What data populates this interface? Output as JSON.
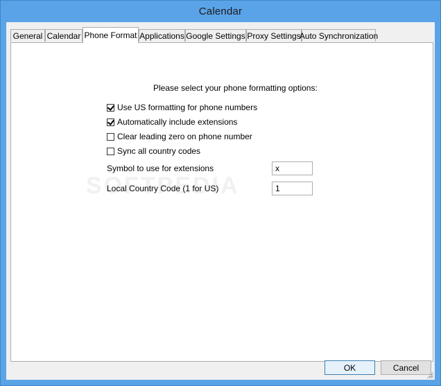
{
  "window": {
    "title": "Calendar"
  },
  "tabs": [
    {
      "label": "General"
    },
    {
      "label": "Calendar"
    },
    {
      "label": "Phone Format"
    },
    {
      "label": "Applications"
    },
    {
      "label": "Google Settings"
    },
    {
      "label": "Proxy Settings"
    },
    {
      "label": "Auto Synchronization"
    }
  ],
  "phone_format": {
    "prompt": "Please select your phone formatting options:",
    "options": [
      {
        "label": "Use US formatting for phone numbers",
        "checked": true
      },
      {
        "label": "Automatically include extensions",
        "checked": true
      },
      {
        "label": "Clear leading zero on phone number",
        "checked": false
      },
      {
        "label": "Sync all country codes",
        "checked": false
      }
    ],
    "extension_symbol": {
      "label": "Symbol to use for extensions",
      "value": "x"
    },
    "country_code": {
      "label": "Local Country Code (1 for US)",
      "value": "1"
    }
  },
  "watermark": "SOFTPEDIA",
  "buttons": {
    "ok": "OK",
    "cancel": "Cancel"
  },
  "colors": {
    "titlebar": "#5ba3e8",
    "dialog": "#f0f0f0",
    "panel": "#ffffff",
    "default_button": "#e5f1fb"
  }
}
